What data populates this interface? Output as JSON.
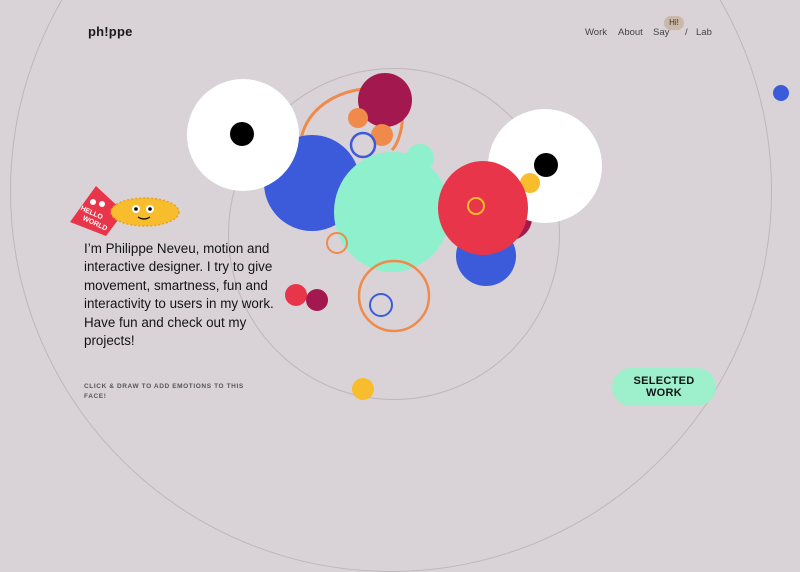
{
  "brand": {
    "logo": "ph!ppe"
  },
  "nav": {
    "work": "Work",
    "about": "About",
    "say": "Say",
    "hi": "Hi!",
    "slash": "/",
    "lab": "Lab"
  },
  "sticker": {
    "text_line1": "HELLO",
    "text_line2": "WORLD"
  },
  "intro": {
    "text": "I’m Philippe Neveu, motion and interactive designer. I try to give movement, smartness, fun and interactivity to users in my work. Have fun and check out my projects!"
  },
  "hint": {
    "text": "CLICK & DRAW TO ADD EMOTIONS TO THIS FACE!"
  },
  "cta": {
    "line1": "SELECTED",
    "line2": "WORK"
  },
  "colors": {
    "background": "#d9d3d8",
    "blue": "#3b5bdb",
    "mint": "#8ef0cc",
    "red": "#e8354a",
    "maroon": "#a3194f",
    "orange": "#f08a4b",
    "yellow": "#f7bd2c",
    "white": "#ffffff"
  }
}
